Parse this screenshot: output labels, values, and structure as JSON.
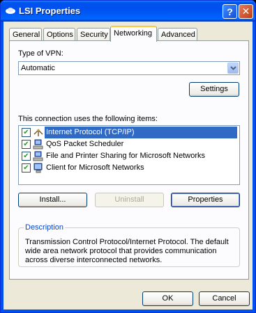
{
  "window": {
    "title": "LSI Properties",
    "help_label": "?",
    "close_label": "✕"
  },
  "tabs": [
    {
      "label": "General",
      "active": false
    },
    {
      "label": "Options",
      "active": false
    },
    {
      "label": "Security",
      "active": false
    },
    {
      "label": "Networking",
      "active": true
    },
    {
      "label": "Advanced",
      "active": false
    }
  ],
  "vpn": {
    "label": "Type of VPN:",
    "selected": "Automatic",
    "settings_label": "Settings"
  },
  "items": {
    "label": "This connection uses the following items:",
    "list": [
      {
        "label": "Internet Protocol (TCP/IP)",
        "checked": true,
        "selected": true,
        "icon": "protocol-icon"
      },
      {
        "label": "QoS Packet Scheduler",
        "checked": true,
        "selected": false,
        "icon": "service-icon"
      },
      {
        "label": "File and Printer Sharing for Microsoft Networks",
        "checked": true,
        "selected": false,
        "icon": "service-icon"
      },
      {
        "label": "Client for Microsoft Networks",
        "checked": true,
        "selected": false,
        "icon": "client-icon"
      }
    ]
  },
  "actions": {
    "install_label": "Install...",
    "uninstall_label": "Uninstall",
    "properties_label": "Properties"
  },
  "description": {
    "legend": "Description",
    "text": "Transmission Control Protocol/Internet Protocol. The default wide area network protocol that provides communication across diverse interconnected networks."
  },
  "footer": {
    "ok_label": "OK",
    "cancel_label": "Cancel"
  },
  "colors": {
    "titlebar": "#0050ee",
    "selection": "#316ac5",
    "dialog_bg": "#ece9d8",
    "description_legend": "#0046d5"
  }
}
